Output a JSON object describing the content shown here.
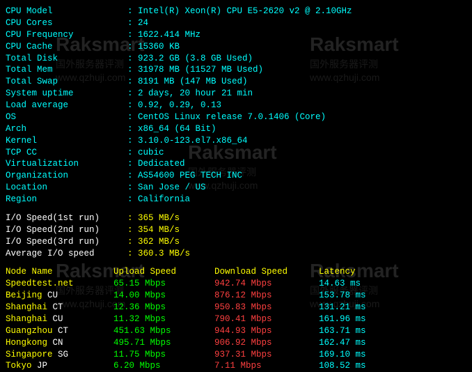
{
  "watermark": {
    "brand": "Raksmart",
    "line1": "国外服务器评测",
    "line2": "www.qzhuji.com"
  },
  "sys": [
    {
      "label": "CPU Model",
      "value": "Intel(R) Xeon(R) CPU E5-2620 v2 @ 2.10GHz"
    },
    {
      "label": "CPU Cores",
      "value": "24"
    },
    {
      "label": "CPU Frequency",
      "value": "1622.414 MHz"
    },
    {
      "label": "CPU Cache",
      "value": "15360 KB"
    },
    {
      "label": "Total Disk",
      "value": "923.2 GB (3.8 GB Used)"
    },
    {
      "label": "Total Mem",
      "value": "31978 MB (11527 MB Used)"
    },
    {
      "label": "Total Swap",
      "value": "8191 MB (147 MB Used)"
    },
    {
      "label": "System uptime",
      "value": "2 days, 20 hour 21 min"
    },
    {
      "label": "Load average",
      "value": "0.92, 0.29, 0.13"
    },
    {
      "label": "OS",
      "value": "CentOS Linux release 7.0.1406 (Core)"
    },
    {
      "label": "Arch",
      "value": "x86_64 (64 Bit)"
    },
    {
      "label": "Kernel",
      "value": "3.10.0-123.el7.x86_64"
    },
    {
      "label": "TCP CC",
      "value": "cubic"
    },
    {
      "label": "Virtualization",
      "value": "Dedicated"
    },
    {
      "label": "Organization",
      "value": "AS54600 PEG TECH INC"
    },
    {
      "label": "Location",
      "value": "San Jose / US"
    },
    {
      "label": "Region",
      "value": "California"
    }
  ],
  "io": [
    {
      "label": "I/O Speed(1st run)",
      "value": "365 MB/s"
    },
    {
      "label": "I/O Speed(2nd run)",
      "value": "354 MB/s"
    },
    {
      "label": "I/O Speed(3rd run)",
      "value": "362 MB/s"
    },
    {
      "label": "Average I/O speed",
      "value": "360.3 MB/s"
    }
  ],
  "speed_header": {
    "node": "Node Name",
    "up": "Upload Speed",
    "down": "Download Speed",
    "lat": "Latency"
  },
  "speed": [
    {
      "node": "Speedtest.net",
      "code": "",
      "up": "65.15 Mbps",
      "down": "942.74 Mbps",
      "lat": "14.63 ms"
    },
    {
      "node": "Beijing",
      "code": "CU",
      "up": "14.00 Mbps",
      "down": "876.12 Mbps",
      "lat": "153.78 ms"
    },
    {
      "node": "Shanghai",
      "code": "CT",
      "up": "12.36 Mbps",
      "down": "950.83 Mbps",
      "lat": "131.21 ms"
    },
    {
      "node": "Shanghai",
      "code": "CU",
      "up": "11.32 Mbps",
      "down": "790.41 Mbps",
      "lat": "161.96 ms"
    },
    {
      "node": "Guangzhou",
      "code": "CT",
      "up": "451.63 Mbps",
      "down": "944.93 Mbps",
      "lat": "163.71 ms"
    },
    {
      "node": "Hongkong",
      "code": "CN",
      "up": "495.71 Mbps",
      "down": "906.92 Mbps",
      "lat": "162.47 ms"
    },
    {
      "node": "Singapore",
      "code": "SG",
      "up": "11.75 Mbps",
      "down": "937.31 Mbps",
      "lat": "169.10 ms"
    },
    {
      "node": "Tokyo",
      "code": "JP",
      "up": "6.20 Mbps",
      "down": "7.11 Mbps",
      "lat": "108.52 ms"
    }
  ]
}
